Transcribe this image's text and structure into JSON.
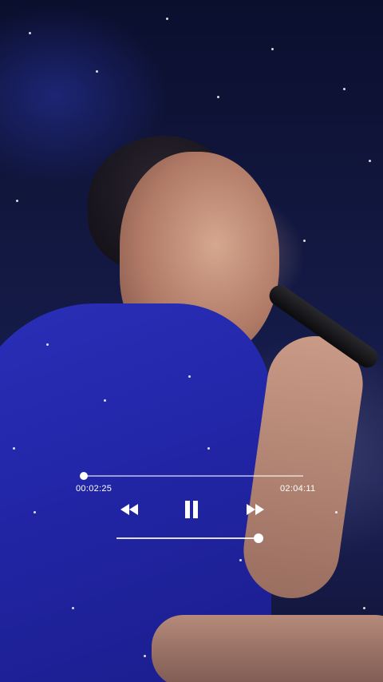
{
  "player": {
    "elapsed_time": "00:02:25",
    "total_time": "02:04:11",
    "progress_fraction": 0.019,
    "volume_fraction": 1.0,
    "controls": {
      "rewind_icon": "rewind-icon",
      "pause_icon": "pause-icon",
      "forward_icon": "fast-forward-icon"
    }
  },
  "colors": {
    "control_color": "#ffffff",
    "shirt_color": "#2226a8"
  }
}
